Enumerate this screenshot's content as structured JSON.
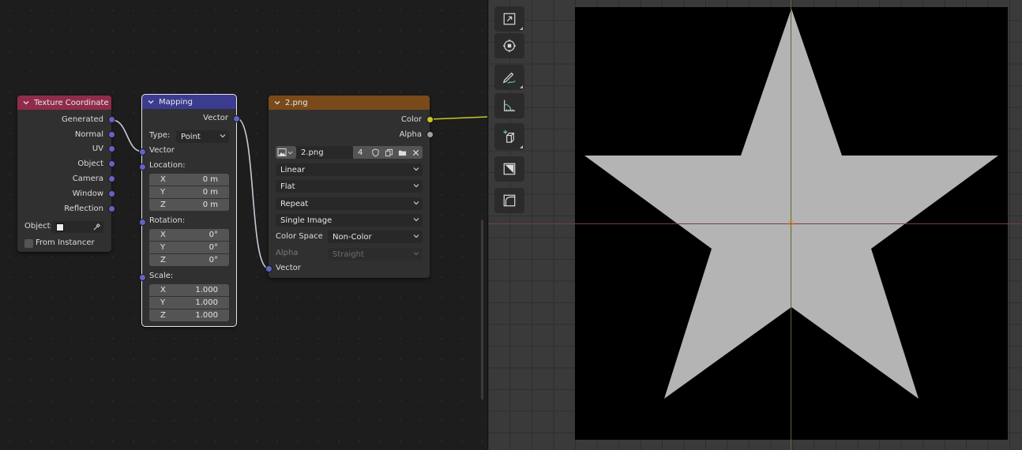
{
  "texture_coordinate": {
    "title": "Texture Coordinate",
    "outputs": [
      "Generated",
      "Normal",
      "UV",
      "Object",
      "Camera",
      "Window",
      "Reflection"
    ],
    "object_label": "Object:",
    "from_instancer": "From Instancer"
  },
  "mapping": {
    "title": "Mapping",
    "output": "Vector",
    "type_label": "Type:",
    "type_value": "Point",
    "input_vector": "Vector",
    "location_label": "Location:",
    "rotation_label": "Rotation:",
    "scale_label": "Scale:",
    "location": [
      {
        "axis": "X",
        "value": "0 m"
      },
      {
        "axis": "Y",
        "value": "0 m"
      },
      {
        "axis": "Z",
        "value": "0 m"
      }
    ],
    "rotation": [
      {
        "axis": "X",
        "value": "0°"
      },
      {
        "axis": "Y",
        "value": "0°"
      },
      {
        "axis": "Z",
        "value": "0°"
      }
    ],
    "scale": [
      {
        "axis": "X",
        "value": "1.000"
      },
      {
        "axis": "Y",
        "value": "1.000"
      },
      {
        "axis": "Z",
        "value": "1.000"
      }
    ]
  },
  "image_texture": {
    "title": "2.png",
    "out_color": "Color",
    "out_alpha": "Alpha",
    "image_name": "2.png",
    "users": "4",
    "interpolation": "Linear",
    "projection": "Flat",
    "extension": "Repeat",
    "source": "Single Image",
    "color_space_label": "Color Space",
    "color_space": "Non-Color",
    "alpha_label": "Alpha",
    "alpha_mode": "Straight",
    "in_vector": "Vector"
  },
  "toolbar": {
    "tools": [
      "scale-tool-icon",
      "transform-tool-icon",
      "annotate-tool-icon",
      "measure-tool-icon",
      "add-cube-icon",
      "sample-tool-icon",
      "rip-tool-icon"
    ]
  },
  "colors": {
    "tex_coord_header": "#8f2c49",
    "mapping_header": "#3b3b8f",
    "image_header": "#7a4a1a",
    "vector_socket": "#6363c7",
    "color_socket": "#c7c729",
    "link_color": "#c7c7d7",
    "color_link": "#c7c729",
    "star_fill": "#b4b4b4"
  }
}
